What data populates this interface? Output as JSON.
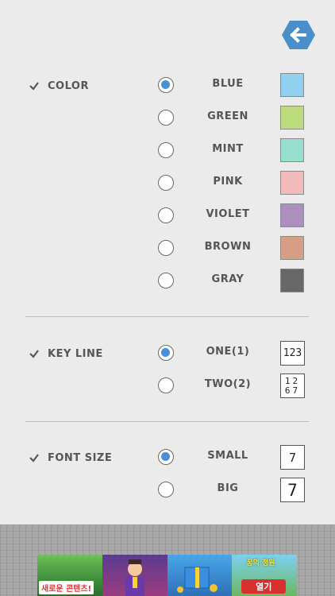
{
  "colors": {
    "accent": "#4a90d9",
    "back_button": "#4a8fc9"
  },
  "back_button": {
    "icon": "arrow-left-icon"
  },
  "color_section": {
    "label": "COLOR",
    "options": [
      {
        "label": "BLUE",
        "swatch": "#8fd1ef",
        "selected": true
      },
      {
        "label": "GREEN",
        "swatch": "#bcdc7e",
        "selected": false
      },
      {
        "label": "MINT",
        "swatch": "#98dfcf",
        "selected": false
      },
      {
        "label": "PINK",
        "swatch": "#f2bcbc",
        "selected": false
      },
      {
        "label": "VIOLET",
        "swatch": "#ab8fbf",
        "selected": false
      },
      {
        "label": "BROWN",
        "swatch": "#d59f85",
        "selected": false
      },
      {
        "label": "GRAY",
        "swatch": "#676767",
        "selected": false
      }
    ]
  },
  "key_line_section": {
    "label": "KEY LINE",
    "options": [
      {
        "label": "ONE(1)",
        "preview_line1": "123",
        "preview_line2": "",
        "selected": true
      },
      {
        "label": "TWO(2)",
        "preview_line1": "12",
        "preview_line2": "67",
        "selected": false
      }
    ]
  },
  "font_size_section": {
    "label": "FONT SIZE",
    "options": [
      {
        "label": "SMALL",
        "preview": "7",
        "selected": true
      },
      {
        "label": "BIG",
        "preview": "7",
        "selected": false
      }
    ]
  },
  "ad": {
    "caption_left": "새로운 콘텐츠!",
    "caption_top": "꿈의 정원",
    "button": "열기"
  }
}
